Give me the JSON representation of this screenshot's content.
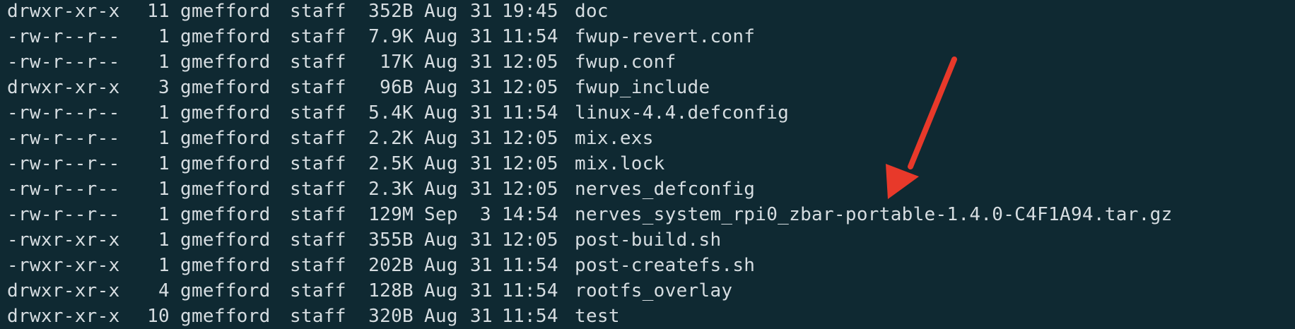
{
  "listing": [
    {
      "perm": "drwxr-xr-x",
      "links": "11",
      "owner": "gmefford",
      "group": "staff",
      "size": "352B",
      "month": "Aug",
      "day": "31",
      "time": "19:45",
      "name": "doc"
    },
    {
      "perm": "-rw-r--r--",
      "links": "1",
      "owner": "gmefford",
      "group": "staff",
      "size": "7.9K",
      "month": "Aug",
      "day": "31",
      "time": "11:54",
      "name": "fwup-revert.conf"
    },
    {
      "perm": "-rw-r--r--",
      "links": "1",
      "owner": "gmefford",
      "group": "staff",
      "size": "17K",
      "month": "Aug",
      "day": "31",
      "time": "12:05",
      "name": "fwup.conf"
    },
    {
      "perm": "drwxr-xr-x",
      "links": "3",
      "owner": "gmefford",
      "group": "staff",
      "size": "96B",
      "month": "Aug",
      "day": "31",
      "time": "12:05",
      "name": "fwup_include"
    },
    {
      "perm": "-rw-r--r--",
      "links": "1",
      "owner": "gmefford",
      "group": "staff",
      "size": "5.4K",
      "month": "Aug",
      "day": "31",
      "time": "11:54",
      "name": "linux-4.4.defconfig"
    },
    {
      "perm": "-rw-r--r--",
      "links": "1",
      "owner": "gmefford",
      "group": "staff",
      "size": "2.2K",
      "month": "Aug",
      "day": "31",
      "time": "12:05",
      "name": "mix.exs"
    },
    {
      "perm": "-rw-r--r--",
      "links": "1",
      "owner": "gmefford",
      "group": "staff",
      "size": "2.5K",
      "month": "Aug",
      "day": "31",
      "time": "12:05",
      "name": "mix.lock"
    },
    {
      "perm": "-rw-r--r--",
      "links": "1",
      "owner": "gmefford",
      "group": "staff",
      "size": "2.3K",
      "month": "Aug",
      "day": "31",
      "time": "12:05",
      "name": "nerves_defconfig"
    },
    {
      "perm": "-rw-r--r--",
      "links": "1",
      "owner": "gmefford",
      "group": "staff",
      "size": "129M",
      "month": "Sep",
      "day": "3",
      "time": "14:54",
      "name": "nerves_system_rpi0_zbar-portable-1.4.0-C4F1A94.tar.gz"
    },
    {
      "perm": "-rwxr-xr-x",
      "links": "1",
      "owner": "gmefford",
      "group": "staff",
      "size": "355B",
      "month": "Aug",
      "day": "31",
      "time": "12:05",
      "name": "post-build.sh"
    },
    {
      "perm": "-rwxr-xr-x",
      "links": "1",
      "owner": "gmefford",
      "group": "staff",
      "size": "202B",
      "month": "Aug",
      "day": "31",
      "time": "11:54",
      "name": "post-createfs.sh"
    },
    {
      "perm": "drwxr-xr-x",
      "links": "4",
      "owner": "gmefford",
      "group": "staff",
      "size": "128B",
      "month": "Aug",
      "day": "31",
      "time": "11:54",
      "name": "rootfs_overlay"
    },
    {
      "perm": "drwxr-xr-x",
      "links": "10",
      "owner": "gmefford",
      "group": "staff",
      "size": "320B",
      "month": "Aug",
      "day": "31",
      "time": "11:54",
      "name": "test"
    }
  ],
  "colors": {
    "background": "#0f2932",
    "text": "#d6dde1",
    "annotation": "#e8392a"
  },
  "annotation": {
    "icon": "arrow-icon"
  }
}
